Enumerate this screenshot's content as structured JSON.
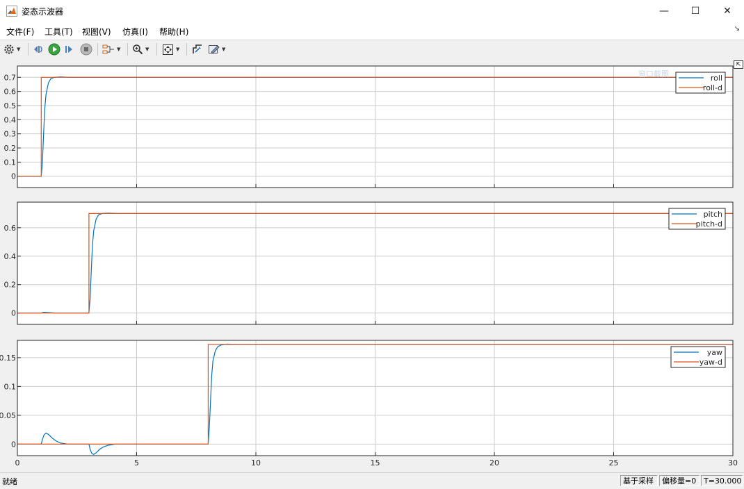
{
  "window": {
    "title": "姿态示波器",
    "controls": {
      "minimize": "—",
      "maximize": "☐",
      "close": "✕"
    }
  },
  "menu": [
    "文件(F)",
    "工具(T)",
    "视图(V)",
    "仿真(I)",
    "帮助(H)"
  ],
  "toolbar": {
    "icons": [
      "gear-icon",
      "step-back-icon",
      "run-icon",
      "step-forward-icon",
      "stop-icon",
      "signal-selector-icon",
      "zoom-icon",
      "fit-to-view-icon",
      "cursor-measure-icon",
      "style-icon"
    ]
  },
  "overlay_text": "窗口截图",
  "status": {
    "left": "就绪",
    "sample_mode": "基于采样",
    "offset": "偏移量=0",
    "time": "T=30.000"
  },
  "colors": {
    "actual": "#0072bd",
    "desired": "#d95319",
    "axes_bg": "#ffffff",
    "figure_bg": "#f0f0f0",
    "grid": "#cbcbcb"
  },
  "chart_data": [
    {
      "type": "line",
      "xlim": [
        0,
        30
      ],
      "ylim": [
        -0.08,
        0.78
      ],
      "yticks": [
        0,
        0.1,
        0.2,
        0.3,
        0.4,
        0.5,
        0.6,
        0.7
      ],
      "yticklabels": [
        "0",
        "0.1",
        "0.2",
        "0.3",
        "0.4",
        "0.5",
        "0.6",
        "0.7"
      ],
      "xticks": [
        0,
        5,
        10,
        15,
        20,
        25,
        30
      ],
      "grid": true,
      "legend_position": "top-right",
      "series": [
        {
          "name": "roll",
          "role": "actual",
          "x": [
            0,
            1.0,
            1.05,
            1.1,
            1.15,
            1.2,
            1.3,
            1.4,
            1.55,
            1.8,
            2.2,
            3.0,
            30
          ],
          "y": [
            0,
            0,
            0.1,
            0.3,
            0.48,
            0.58,
            0.66,
            0.69,
            0.7,
            0.703,
            0.7,
            0.7,
            0.7
          ]
        },
        {
          "name": "roll-d",
          "role": "desired",
          "x": [
            0,
            1.0,
            1.0,
            30
          ],
          "y": [
            0,
            0,
            0.7,
            0.7
          ]
        }
      ]
    },
    {
      "type": "line",
      "xlim": [
        0,
        30
      ],
      "ylim": [
        -0.08,
        0.78
      ],
      "yticks": [
        0,
        0.2,
        0.4,
        0.6
      ],
      "yticklabels": [
        "0",
        "0.2",
        "0.4",
        "0.6"
      ],
      "xticks": [
        0,
        5,
        10,
        15,
        20,
        25,
        30
      ],
      "grid": true,
      "legend_position": "top-right",
      "series": [
        {
          "name": "pitch",
          "role": "actual",
          "x": [
            0,
            1.0,
            1.1,
            1.3,
            1.6,
            3.0,
            3.05,
            3.1,
            3.15,
            3.2,
            3.3,
            3.4,
            3.55,
            3.8,
            4.2,
            30
          ],
          "y": [
            0,
            0,
            0.005,
            0.003,
            0,
            0,
            0.1,
            0.3,
            0.48,
            0.58,
            0.66,
            0.69,
            0.7,
            0.703,
            0.7,
            0.7
          ]
        },
        {
          "name": "pitch-d",
          "role": "desired",
          "x": [
            0,
            3.0,
            3.0,
            30
          ],
          "y": [
            0,
            0,
            0.7,
            0.7
          ]
        }
      ]
    },
    {
      "type": "line",
      "xlim": [
        0,
        30
      ],
      "ylim": [
        -0.02,
        0.18
      ],
      "yticks": [
        0,
        0.05,
        0.1,
        0.15
      ],
      "yticklabels": [
        "0",
        "0.05",
        "0.1",
        "0.15"
      ],
      "xticks": [
        0,
        5,
        10,
        15,
        20,
        25,
        30
      ],
      "xticklabels": [
        "0",
        "5",
        "10",
        "15",
        "20",
        "25",
        "30"
      ],
      "grid": true,
      "legend_position": "top-right",
      "series": [
        {
          "name": "yaw",
          "role": "actual",
          "x": [
            0,
            1.0,
            1.05,
            1.12,
            1.2,
            1.3,
            1.45,
            1.6,
            1.8,
            2.1,
            2.5,
            3.0,
            3.05,
            3.12,
            3.2,
            3.3,
            3.45,
            3.6,
            3.8,
            4.1,
            4.5,
            8.0,
            8.05,
            8.1,
            8.15,
            8.2,
            8.3,
            8.4,
            8.55,
            8.8,
            9.2,
            30
          ],
          "y": [
            0,
            0,
            0.008,
            0.016,
            0.019,
            0.017,
            0.011,
            0.006,
            0.002,
            0,
            0,
            0,
            -0.009,
            -0.016,
            -0.018,
            -0.015,
            -0.009,
            -0.005,
            -0.002,
            0,
            0,
            0,
            0.03,
            0.075,
            0.12,
            0.145,
            0.162,
            0.169,
            0.172,
            0.1735,
            0.173,
            0.173
          ]
        },
        {
          "name": "yaw-d",
          "role": "desired",
          "x": [
            0,
            8.0,
            8.0,
            30
          ],
          "y": [
            0,
            0,
            0.173,
            0.173
          ]
        }
      ]
    }
  ]
}
